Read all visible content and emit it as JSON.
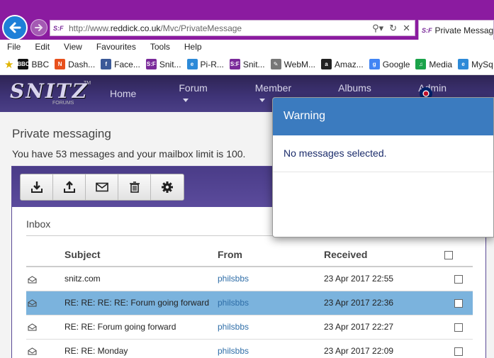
{
  "browser": {
    "url_prefix": "http://www.",
    "url_host": "reddick.co.uk",
    "url_path": "/Mvc/PrivateMessage",
    "tab_title": "Private Messaging",
    "site_badge": "S:F"
  },
  "menu": [
    "File",
    "Edit",
    "View",
    "Favourites",
    "Tools",
    "Help"
  ],
  "favourites": [
    {
      "label": "BBC",
      "icon": "bbc-icon",
      "color": "#111111",
      "glyph": "BBC"
    },
    {
      "label": "Dash...",
      "icon": "dash-icon",
      "color": "#e8501c",
      "glyph": "N"
    },
    {
      "label": "Face...",
      "icon": "facebook-icon",
      "color": "#3b5998",
      "glyph": "f"
    },
    {
      "label": "Snit...",
      "icon": "snitz-icon",
      "color": "#7a2a9a",
      "glyph": "S:F"
    },
    {
      "label": "Pi-R...",
      "icon": "ie-page-icon",
      "color": "#2d8ad8",
      "glyph": "e"
    },
    {
      "label": "Snit...",
      "icon": "snitz-icon",
      "color": "#7a2a9a",
      "glyph": "S:F"
    },
    {
      "label": "WebM...",
      "icon": "webmail-icon",
      "color": "#777777",
      "glyph": "✎"
    },
    {
      "label": "Amaz...",
      "icon": "amazon-icon",
      "color": "#222222",
      "glyph": "a"
    },
    {
      "label": "Google",
      "icon": "google-icon",
      "color": "#4285f4",
      "glyph": "g"
    },
    {
      "label": "Media",
      "icon": "media-icon",
      "color": "#1ba34a",
      "glyph": "♫"
    },
    {
      "label": "MySq",
      "icon": "ie-page-icon",
      "color": "#2d8ad8",
      "glyph": "e"
    }
  ],
  "site": {
    "logo_text": "SNITZ",
    "logo_sub": "FORUMS",
    "logo_tm": "TM",
    "nav": [
      {
        "label": "Home",
        "dropdown": false
      },
      {
        "label": "Forum",
        "dropdown": true
      },
      {
        "label": "Member",
        "dropdown": true
      },
      {
        "label": "Albums",
        "dropdown": true
      },
      {
        "label": "Admin",
        "dropdown": true
      }
    ]
  },
  "page": {
    "title": "Private messaging",
    "mailbox_info": "You have 53 messages and your mailbox limit is 100.",
    "folder": "Inbox",
    "toolbar": [
      {
        "name": "download-button",
        "icon": "download-icon"
      },
      {
        "name": "upload-button",
        "icon": "upload-icon"
      },
      {
        "name": "compose-button",
        "icon": "envelope-icon"
      },
      {
        "name": "delete-button",
        "icon": "trash-icon"
      },
      {
        "name": "settings-button",
        "icon": "gear-icon"
      }
    ],
    "columns": {
      "subject": "Subject",
      "from": "From",
      "received": "Received"
    },
    "messages": [
      {
        "subject": "snitz.com",
        "from": "philsbbs",
        "received": "23 Apr 2017 22:55",
        "selected": false
      },
      {
        "subject": "RE: RE: RE: RE: Forum going forward",
        "from": "philsbbs",
        "received": "23 Apr 2017 22:36",
        "selected": true
      },
      {
        "subject": "RE: RE: Forum going forward",
        "from": "philsbbs",
        "received": "23 Apr 2017 22:27",
        "selected": false
      },
      {
        "subject": "RE: RE: Monday",
        "from": "philsbbs",
        "received": "23 Apr 2017 22:09",
        "selected": false
      }
    ]
  },
  "modal": {
    "title": "Warning",
    "message": "No messages selected."
  }
}
